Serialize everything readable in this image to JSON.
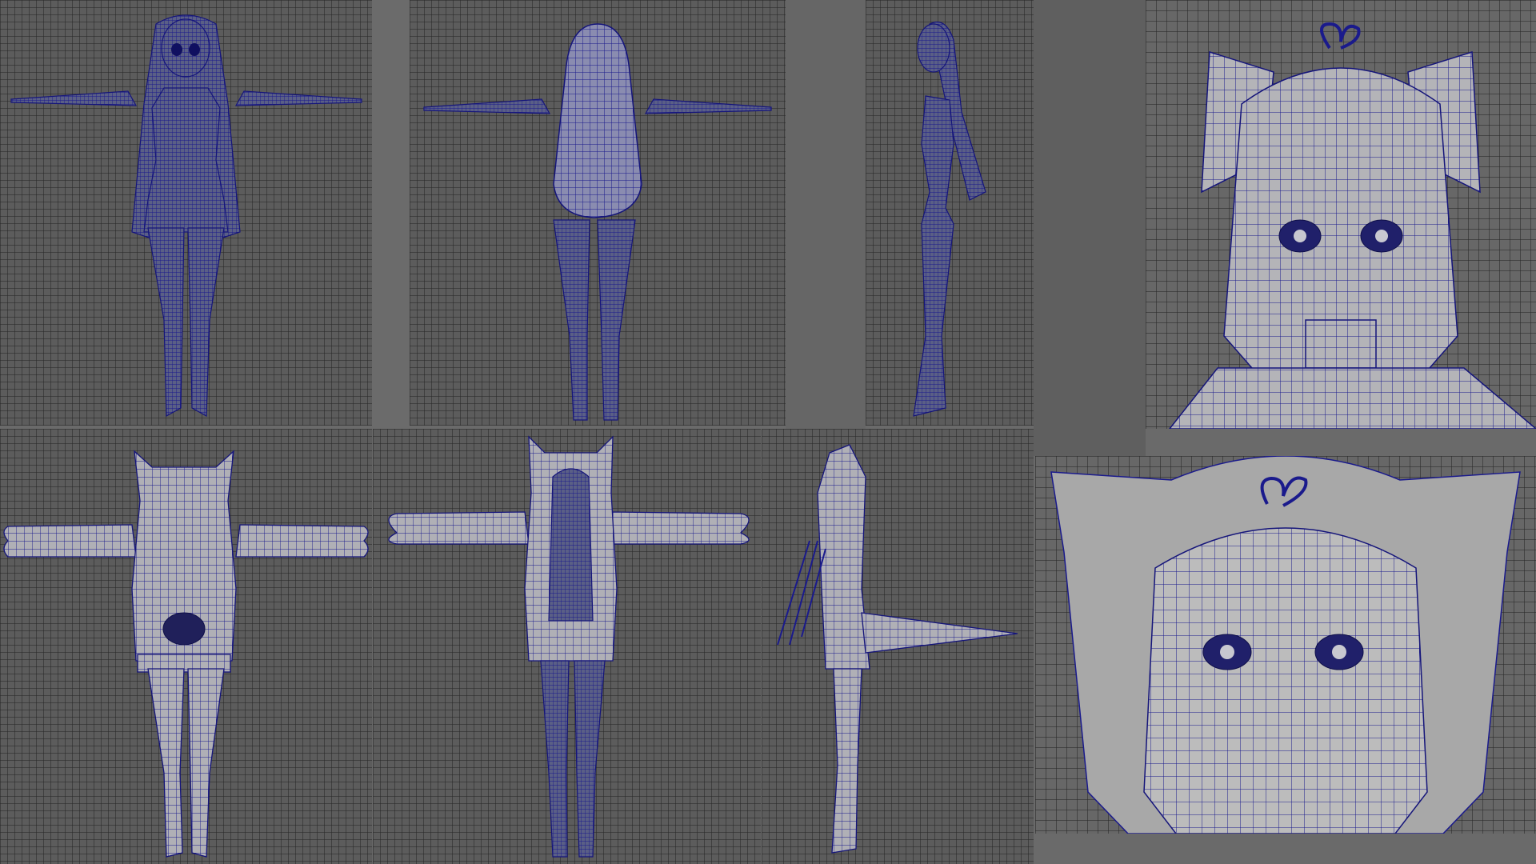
{
  "app": {
    "title": "",
    "colors": {
      "wire": "#1a1a8c",
      "mesh_fill": "#8e8e9e",
      "shaded_fill": "#b8b8b8",
      "viewport_bg": "#5c5c5c",
      "grid": "#3a3a3a"
    }
  },
  "viewports": [
    {
      "id": "front-wireframe",
      "mode": "wireframe",
      "view": "front"
    },
    {
      "id": "back-wireframe",
      "mode": "wireframe",
      "view": "back"
    },
    {
      "id": "side-wireframe",
      "mode": "wireframe",
      "view": "side"
    },
    {
      "id": "head-closeup",
      "mode": "wireframe-on-shaded",
      "view": "front-zoom"
    },
    {
      "id": "hoodie-back",
      "mode": "wireframe-on-shaded",
      "view": "back"
    },
    {
      "id": "hoodie-front",
      "mode": "wireframe-on-shaded",
      "view": "front"
    },
    {
      "id": "hoodie-side",
      "mode": "wireframe-on-shaded",
      "view": "side"
    },
    {
      "id": "hoodie-head-closeup",
      "mode": "wireframe-on-shaded",
      "view": "front-zoom"
    }
  ]
}
